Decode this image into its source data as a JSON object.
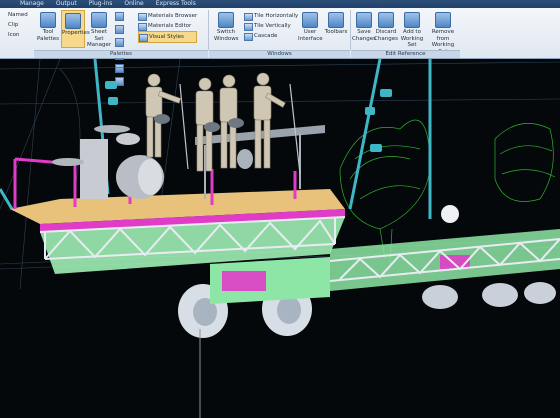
{
  "tabs": [
    "Manage",
    "Output",
    "Plug-ins",
    "Online",
    "Express Tools"
  ],
  "left_list": [
    "Named",
    "Clip",
    "Icon"
  ],
  "buttons": {
    "tool_palettes": "Tool Palettes",
    "properties": "Properties",
    "sheet_set_manager": "Sheet Set Manager",
    "materials_browser": "Materials Browser",
    "materials_editor": "Materials Editor",
    "visual_styles": "Visual Styles",
    "switch_windows": "Switch Windows",
    "tile_horizontally": "Tile Horizontally",
    "tile_vertically": "Tile Vertically",
    "cascade": "Cascade",
    "user_interface": "User Interface",
    "toolbars": "Toolbars",
    "save_changes": "Save Changes",
    "discard_changes": "Discard Changes",
    "add_to_working_set": "Add to Working Set",
    "remove_from_working_set": "Remove from Working Set"
  },
  "panels": {
    "palettes": "Palettes",
    "windows": "Windows",
    "edit_reference": "Edit Reference"
  },
  "colors": {
    "ribbon_bg": "#e8eef6",
    "viewport_bg": "#05080b",
    "deck": "#e8c27a",
    "truss": "#d9dfe8",
    "magenta": "#e03cc8",
    "green_rail": "#5fe08a",
    "cyan": "#3fb6c6",
    "tree_green": "#2fb02f"
  },
  "icons": [
    "tool-palettes-icon",
    "properties-icon",
    "sheet-set-icon",
    "materials-icon",
    "visual-styles-icon",
    "switch-windows-icon",
    "user-interface-icon",
    "save-icon",
    "discard-icon",
    "add-set-icon",
    "remove-set-icon"
  ]
}
